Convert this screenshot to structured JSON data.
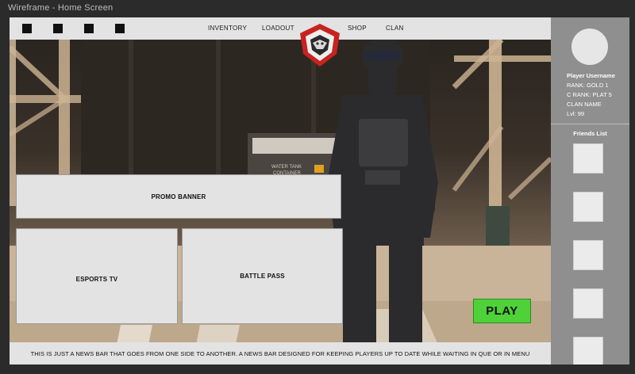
{
  "window": {
    "title": "Wireframe - Home Screen"
  },
  "topbar": {
    "icon_slots": [
      "square-icon",
      "square-icon",
      "square-icon",
      "square-icon"
    ],
    "nav": [
      "INVENTORY",
      "LOADOUT",
      "SHOP",
      "CLAN"
    ]
  },
  "main": {
    "promo_label": "PROMO BANNER",
    "esports_label": "ESPORTS TV",
    "battlepass_label": "BATTLE PASS",
    "play_label": "PLAY",
    "news_text": "THIS IS JUST A NEWS BAR THAT GOES FROM ONE SIDE TO ANOTHER. A NEWS BAR DESIGNED FOR KEEPING PLAYERS UP TO DATE WHILE WAITING IN QUE OR IN MENU"
  },
  "player": {
    "username": "Player Username",
    "rank": "RANK: GOLD 1",
    "c_rank": "C RANK: PLAT 5",
    "clan": "CLAN NAME",
    "level": "Lvl: 99"
  },
  "friends": {
    "title": "Friends List",
    "slots": 5
  },
  "colors": {
    "panel_bg": "#e3e3e3",
    "sidebar_bg": "#8f8f8f",
    "play_green": "#4fd13a",
    "logo_red": "#c8231f"
  }
}
